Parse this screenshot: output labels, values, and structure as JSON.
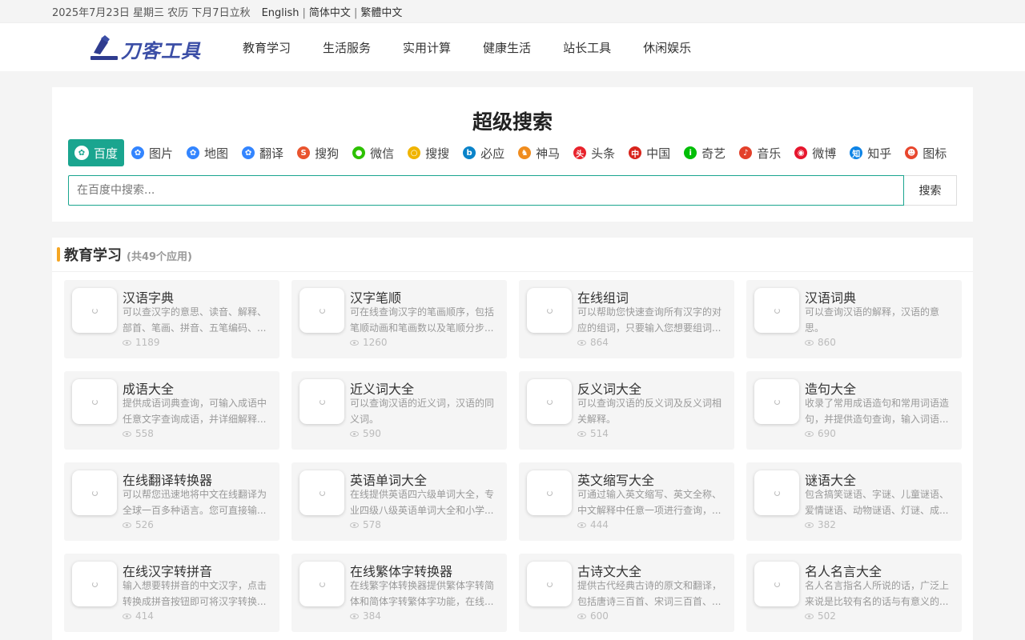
{
  "topbar": {
    "date": "2025年7月23日 星期三 农历 下月7日立秋",
    "languages": [
      "English",
      "简体中文",
      "繁體中文"
    ]
  },
  "header": {
    "logo_text": "刀客工具",
    "nav": [
      "教育学习",
      "生活服务",
      "实用计算",
      "健康生活",
      "站长工具",
      "休闲娱乐"
    ]
  },
  "search": {
    "title": "超级搜索",
    "engines": [
      {
        "label": "百度",
        "icon": "baidu-paw-icon",
        "color": "#2932e1",
        "glyph": "✿",
        "active": true
      },
      {
        "label": "图片",
        "icon": "baidu-paw-icon",
        "color": "#3385ff",
        "glyph": "✿"
      },
      {
        "label": "地图",
        "icon": "baidu-paw-icon",
        "color": "#3385ff",
        "glyph": "✿"
      },
      {
        "label": "翻译",
        "icon": "baidu-paw-icon",
        "color": "#3385ff",
        "glyph": "✿"
      },
      {
        "label": "搜狗",
        "icon": "sogou-icon",
        "color": "#e9542e",
        "glyph": "S"
      },
      {
        "label": "微信",
        "icon": "wechat-icon",
        "color": "#2dc100",
        "glyph": "●"
      },
      {
        "label": "搜搜",
        "icon": "soso-icon",
        "color": "#f0b400",
        "glyph": "○"
      },
      {
        "label": "必应",
        "icon": "bing-icon",
        "color": "#0a83c9",
        "glyph": "b"
      },
      {
        "label": "神马",
        "icon": "shenma-icon",
        "color": "#f08c1e",
        "glyph": "♞"
      },
      {
        "label": "头条",
        "icon": "toutiao-icon",
        "color": "#e8232c",
        "glyph": "头"
      },
      {
        "label": "中国",
        "icon": "chinaso-icon",
        "color": "#d8241c",
        "glyph": "中"
      },
      {
        "label": "奇艺",
        "icon": "iqiyi-icon",
        "color": "#00be06",
        "glyph": "i"
      },
      {
        "label": "音乐",
        "icon": "music-icon",
        "color": "#e3402a",
        "glyph": "♪"
      },
      {
        "label": "微博",
        "icon": "weibo-icon",
        "color": "#e6162d",
        "glyph": "◉"
      },
      {
        "label": "知乎",
        "icon": "zhihu-icon",
        "color": "#0e84e6",
        "glyph": "知"
      },
      {
        "label": "图标",
        "icon": "iconfont-icon",
        "color": "#e8462d",
        "glyph": "☻"
      }
    ],
    "placeholder": "在百度中搜索...",
    "button_label": "搜索"
  },
  "section": {
    "title": "教育学习",
    "count": "(共49个应用)",
    "cards": [
      {
        "title": "汉语字典",
        "desc": "可以查汉字的意思、读音、解释、部首、笔画、拼音、五笔编码、...",
        "views": "1189"
      },
      {
        "title": "汉字笔顺",
        "desc": "可在线查询汉字的笔画顺序，包括笔顺动画和笔画数以及笔顺分步...",
        "views": "1260"
      },
      {
        "title": "在线组词",
        "desc": "可以帮助您快速查询所有汉字的对应的组词，只要输入您想要组词...",
        "views": "864"
      },
      {
        "title": "汉语词典",
        "desc": "可以查询汉语的解释，汉语的意思。",
        "views": "860"
      },
      {
        "title": "成语大全",
        "desc": "提供成语词典查询，可输入成语中任意文字查询成语，并详细解释...",
        "views": "558"
      },
      {
        "title": "近义词大全",
        "desc": "可以查询汉语的近义词，汉语的同义词。",
        "views": "590"
      },
      {
        "title": "反义词大全",
        "desc": "可以查询汉语的反义词及反义词相关解释。",
        "views": "514"
      },
      {
        "title": "造句大全",
        "desc": "收录了常用成语造句和常用词语造句，并提供造句查询，输入词语...",
        "views": "690"
      },
      {
        "title": "在线翻译转换器",
        "desc": "可以帮您迅速地将中文在线翻译为全球一百多种语言。您可直接输...",
        "views": "526"
      },
      {
        "title": "英语单词大全",
        "desc": "在线提供英语四六级单词大全，专业四级八级英语单词大全和小学...",
        "views": "578"
      },
      {
        "title": "英文缩写大全",
        "desc": "可通过输入英文缩写、英文全称、中文解释中任意一项进行查询，...",
        "views": "444"
      },
      {
        "title": "谜语大全",
        "desc": "包含搞笑谜语、字谜、儿童谜语、爱情谜语、动物谜语、灯谜、成...",
        "views": "382"
      },
      {
        "title": "在线汉字转拼音",
        "desc": "输入想要转拼音的中文汉字，点击转换成拼音按钮即可将汉字转换...",
        "views": "414"
      },
      {
        "title": "在线繁体字转换器",
        "desc": "在线繁字体转换器提供繁体字转简体和简体字转繁体字功能，在线...",
        "views": "384"
      },
      {
        "title": "古诗文大全",
        "desc": "提供古代经典古诗的原文和翻译，包括唐诗三百首、宋词三百首、...",
        "views": "600"
      },
      {
        "title": "名人名言大全",
        "desc": "名人名言指名人所说的话，广泛上来说是比较有名的话与有意义的...",
        "views": "502"
      }
    ]
  }
}
